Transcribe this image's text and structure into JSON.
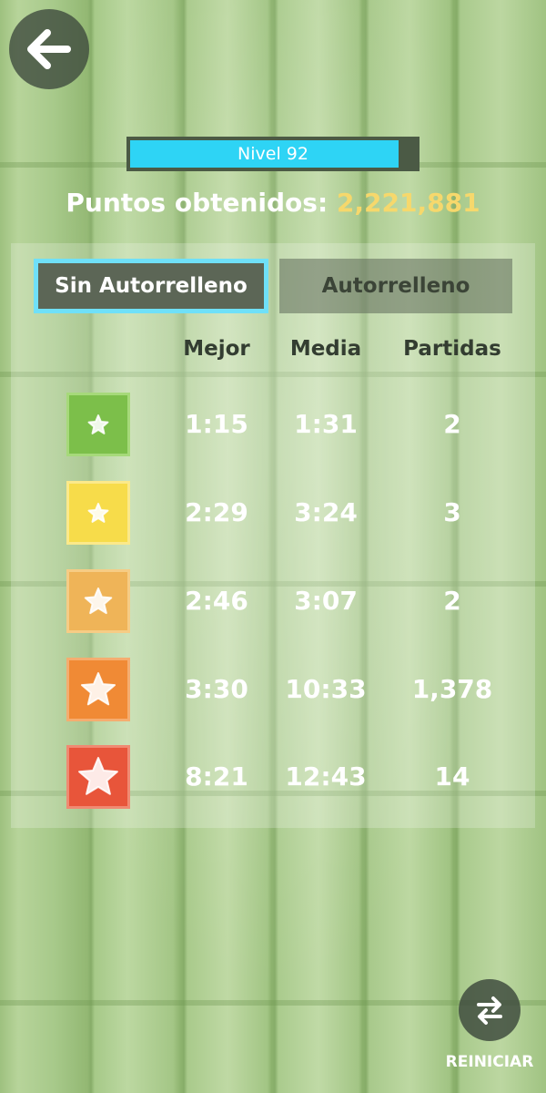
{
  "level": {
    "label": "Nivel 92",
    "progress_fraction": 0.94
  },
  "points": {
    "label": "Puntos obtenidos:",
    "value": "2,221,881"
  },
  "tabs": [
    {
      "label": "Sin Autorrelleno",
      "active": true
    },
    {
      "label": "Autorrelleno",
      "active": false
    }
  ],
  "table": {
    "headers": [
      "Mejor",
      "Media",
      "Partidas"
    ],
    "rows": [
      {
        "color": "#7cbf4a",
        "border": "#a6d97a",
        "star_size": "small",
        "best": "1:15",
        "avg": "1:31",
        "games": "2"
      },
      {
        "color": "#f7dc4a",
        "border": "#fbe98a",
        "star_size": "small",
        "best": "2:29",
        "avg": "3:24",
        "games": "3"
      },
      {
        "color": "#efb458",
        "border": "#f6cc85",
        "star_size": "medium",
        "best": "2:46",
        "avg": "3:07",
        "games": "2"
      },
      {
        "color": "#f08a35",
        "border": "#f5ad70",
        "star_size": "large",
        "best": "3:30",
        "avg": "10:33",
        "games": "1,378"
      },
      {
        "color": "#e8553a",
        "border": "#f08a72",
        "star_size": "xlarge",
        "best": "8:21",
        "avg": "12:43",
        "games": "14"
      }
    ]
  },
  "restart": {
    "label": "REINICIAR"
  },
  "icons": {
    "back": "arrow-left-icon",
    "restart": "swap-arrows-icon",
    "star": "star-icon"
  }
}
